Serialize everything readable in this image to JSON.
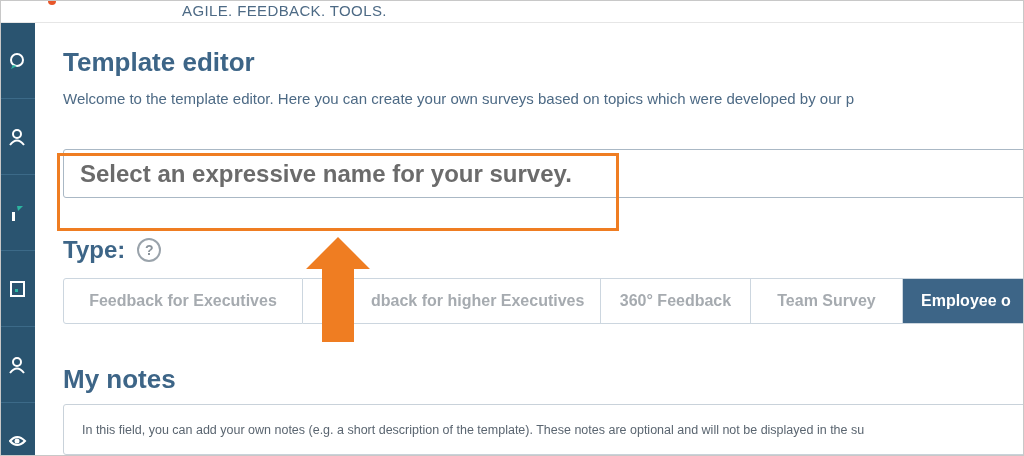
{
  "header": {
    "tagline": "AGILE. FEEDBACK. TOOLS."
  },
  "sidebar": {
    "items": [
      {
        "kind": "chat"
      },
      {
        "kind": "user"
      },
      {
        "kind": "chart"
      },
      {
        "kind": "board"
      },
      {
        "kind": "user"
      },
      {
        "kind": "eye"
      }
    ]
  },
  "page": {
    "title": "Template editor",
    "intro": "Welcome to the template editor. Here you can create your own surveys based on topics which were developed by our p"
  },
  "name_field": {
    "placeholder": "Select an expressive name for your survey."
  },
  "type": {
    "label": "Type:",
    "help": "?",
    "tabs": [
      {
        "label": "Feedback for Executives",
        "selected": false
      },
      {
        "label": "dback for higher Executives",
        "selected": false
      },
      {
        "label": "360° Feedback",
        "selected": false
      },
      {
        "label": "Team Survey",
        "selected": false
      },
      {
        "label": "Employee o",
        "selected": true
      }
    ]
  },
  "notes": {
    "title": "My notes",
    "placeholder": "In this field, you can add your own notes (e.g. a short description of the template). These notes are optional and will not be displayed in the su"
  }
}
